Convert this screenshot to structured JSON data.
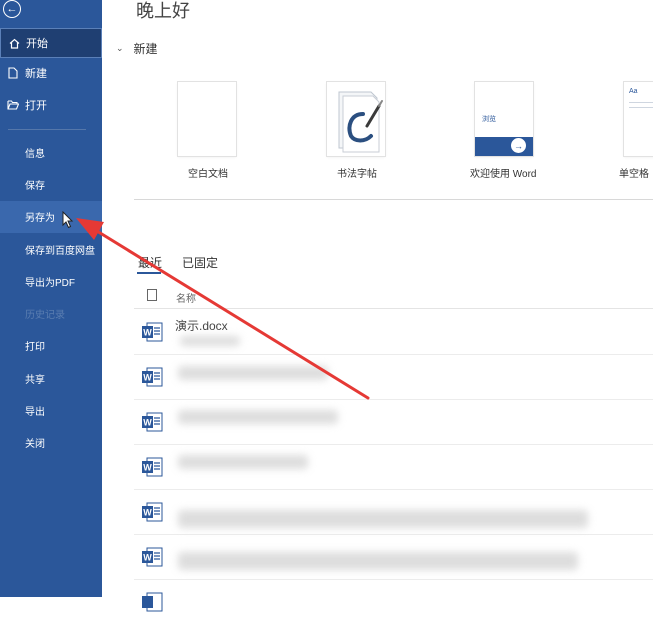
{
  "sidebar": {
    "back_icon": "back-arrow-icon",
    "top_items": [
      {
        "label": "开始",
        "icon": "home-icon",
        "active": true
      },
      {
        "label": "新建",
        "icon": "new-doc-icon"
      },
      {
        "label": "打开",
        "icon": "folder-open-icon"
      }
    ],
    "items": [
      {
        "label": "信息"
      },
      {
        "label": "保存"
      },
      {
        "label": "另存为",
        "hover": true
      },
      {
        "label": "保存到百度网盘"
      },
      {
        "label": "导出为PDF"
      },
      {
        "label": "历史记录",
        "disabled": true
      },
      {
        "label": "打印"
      },
      {
        "label": "共享"
      },
      {
        "label": "导出"
      },
      {
        "label": "关闭"
      }
    ]
  },
  "main": {
    "greeting": "晚上好",
    "new_section_title": "新建",
    "templates": [
      {
        "label": "空白文档"
      },
      {
        "label": "书法字帖"
      },
      {
        "label": "欢迎使用 Word",
        "thumb_text": "浏览"
      },
      {
        "label": "单空格",
        "thumb_text": "Aa"
      }
    ],
    "tabs": [
      {
        "label": "最近",
        "active": true
      },
      {
        "label": "已固定"
      }
    ],
    "column_name": "名称",
    "files": [
      {
        "name": "演示.docx"
      },
      {
        "name": ""
      },
      {
        "name": ""
      },
      {
        "name": ""
      },
      {
        "name": ""
      },
      {
        "name": ""
      }
    ]
  },
  "colors": {
    "sidebar_bg": "#2b579a",
    "accent": "#2b579a",
    "annotation_arrow": "#e53935"
  }
}
